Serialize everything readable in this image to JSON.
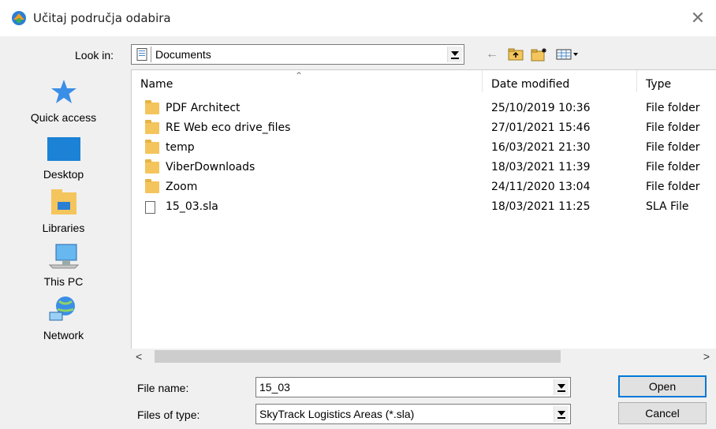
{
  "window": {
    "title": "Učitaj područja odabira",
    "close_symbol": "✕"
  },
  "lookin": {
    "label": "Look in:",
    "value": "Documents"
  },
  "toolbar": {
    "back_symbol": "←"
  },
  "places": [
    {
      "label": "Quick access",
      "icon": "star-icon"
    },
    {
      "label": "Desktop",
      "icon": "desktop-icon"
    },
    {
      "label": "Libraries",
      "icon": "libraries-icon"
    },
    {
      "label": "This PC",
      "icon": "computer-icon"
    },
    {
      "label": "Network",
      "icon": "network-icon"
    }
  ],
  "list": {
    "columns": {
      "name": "Name",
      "date": "Date modified",
      "type": "Type"
    },
    "rows": [
      {
        "name": "PDF Architect",
        "date": "25/10/2019 10:36",
        "type": "File folder",
        "kind": "folder"
      },
      {
        "name": "RE Web eco drive_files",
        "date": "27/01/2021 15:46",
        "type": "File folder",
        "kind": "folder"
      },
      {
        "name": "temp",
        "date": "16/03/2021 21:30",
        "type": "File folder",
        "kind": "folder"
      },
      {
        "name": "ViberDownloads",
        "date": "18/03/2021 11:39",
        "type": "File folder",
        "kind": "folder"
      },
      {
        "name": "Zoom",
        "date": "24/11/2020 13:04",
        "type": "File folder",
        "kind": "folder"
      },
      {
        "name": "15_03.sla",
        "date": "18/03/2021 11:25",
        "type": "SLA File",
        "kind": "file"
      }
    ]
  },
  "scroll": {
    "left": "<",
    "right": ">"
  },
  "filename": {
    "label": "File name:",
    "value": "15_03"
  },
  "filetype": {
    "label": "Files of type:",
    "value": "SkyTrack Logistics Areas (*.sla)"
  },
  "buttons": {
    "open": "Open",
    "cancel": "Cancel"
  },
  "colors": {
    "folder": "#f4c55c",
    "accent": "#0078d7"
  }
}
